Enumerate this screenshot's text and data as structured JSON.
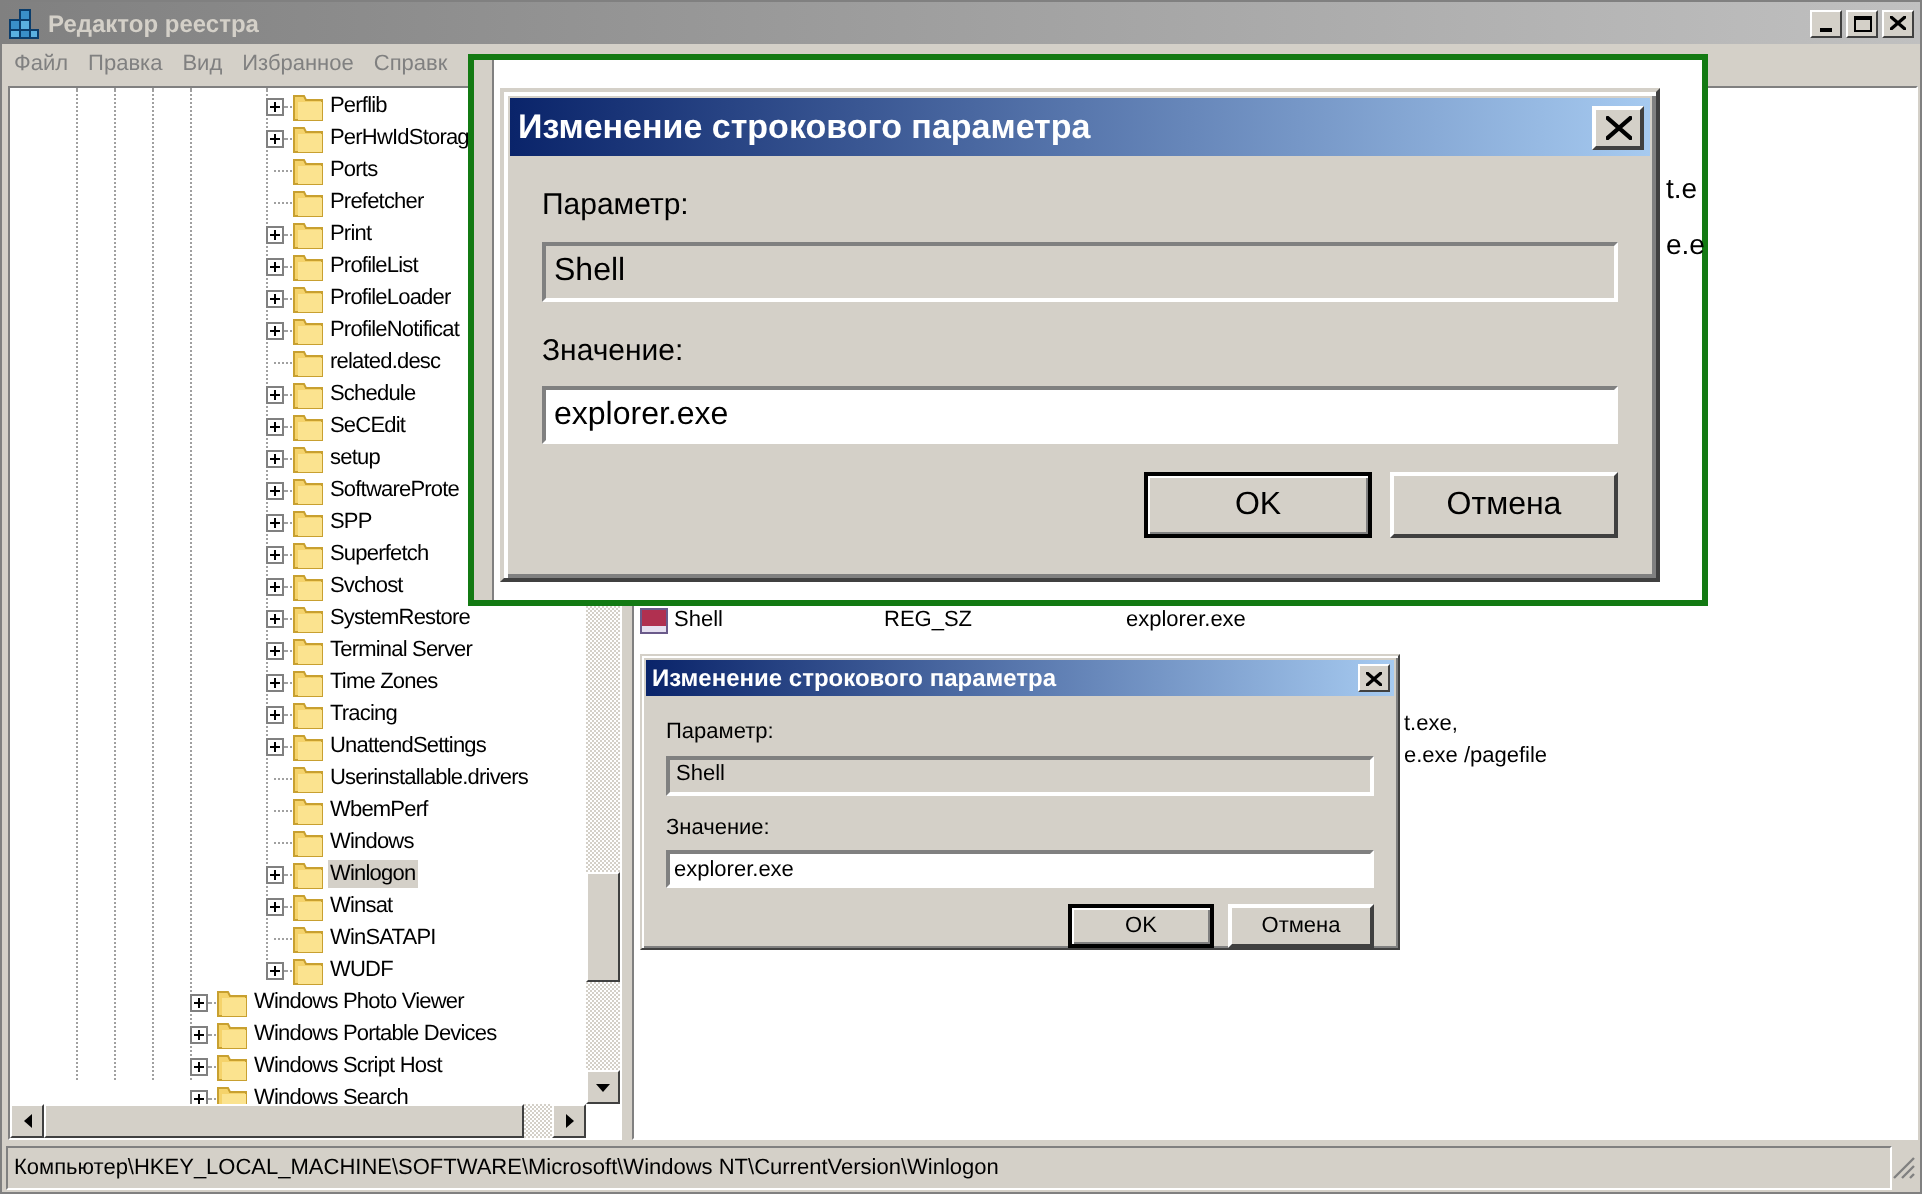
{
  "window": {
    "title": "Редактор реестра"
  },
  "menu": [
    "Файл",
    "Правка",
    "Вид",
    "Избранное",
    "Справк"
  ],
  "tree": {
    "nested_items": [
      {
        "label": "Perflib",
        "expandable": true,
        "selected": false
      },
      {
        "label": "PerHwIdStorag",
        "expandable": true,
        "selected": false
      },
      {
        "label": "Ports",
        "expandable": false,
        "selected": false
      },
      {
        "label": "Prefetcher",
        "expandable": false,
        "selected": false
      },
      {
        "label": "Print",
        "expandable": true,
        "selected": false
      },
      {
        "label": "ProfileList",
        "expandable": true,
        "selected": false
      },
      {
        "label": "ProfileLoader",
        "expandable": true,
        "selected": false
      },
      {
        "label": "ProfileNotificat",
        "expandable": true,
        "selected": false
      },
      {
        "label": "related.desc",
        "expandable": false,
        "selected": false
      },
      {
        "label": "Schedule",
        "expandable": true,
        "selected": false
      },
      {
        "label": "SeCEdit",
        "expandable": true,
        "selected": false
      },
      {
        "label": "setup",
        "expandable": true,
        "selected": false
      },
      {
        "label": "SoftwareProte",
        "expandable": true,
        "selected": false
      },
      {
        "label": "SPP",
        "expandable": true,
        "selected": false
      },
      {
        "label": "Superfetch",
        "expandable": true,
        "selected": false
      },
      {
        "label": "Svchost",
        "expandable": true,
        "selected": false
      },
      {
        "label": "SystemRestore",
        "expandable": true,
        "selected": false
      },
      {
        "label": "Terminal Server",
        "expandable": true,
        "selected": false
      },
      {
        "label": "Time Zones",
        "expandable": true,
        "selected": false
      },
      {
        "label": "Tracing",
        "expandable": true,
        "selected": false
      },
      {
        "label": "UnattendSettings",
        "expandable": true,
        "selected": false
      },
      {
        "label": "Userinstallable.drivers",
        "expandable": false,
        "selected": false
      },
      {
        "label": "WbemPerf",
        "expandable": false,
        "selected": false
      },
      {
        "label": "Windows",
        "expandable": false,
        "selected": false
      },
      {
        "label": "Winlogon",
        "expandable": true,
        "selected": true
      },
      {
        "label": "Winsat",
        "expandable": true,
        "selected": false
      },
      {
        "label": "WinSATAPI",
        "expandable": false,
        "selected": false
      },
      {
        "label": "WUDF",
        "expandable": true,
        "selected": false
      }
    ],
    "items": [
      {
        "label": "Windows Photo Viewer",
        "expandable": true,
        "selected": false
      },
      {
        "label": "Windows Portable Devices",
        "expandable": true,
        "selected": false
      },
      {
        "label": "Windows Script Host",
        "expandable": true,
        "selected": false
      },
      {
        "label": "Windows Search",
        "expandable": true,
        "selected": false
      }
    ]
  },
  "list_rows": [
    {
      "kind": "full",
      "name": "Shell",
      "type": "REG_SZ",
      "data": "explorer.exe"
    },
    {
      "kind": "partial",
      "data": "t.exe,"
    },
    {
      "kind": "partial",
      "data": "e.exe /pagefile"
    }
  ],
  "status_bar": "Компьютер\\HKEY_LOCAL_MACHINE\\SOFTWARE\\Microsoft\\Windows NT\\CurrentVersion\\Winlogon",
  "dialog": {
    "title": "Изменение строкового параметра",
    "parameter_label": "Параметр:",
    "parameter_value": "Shell",
    "value_label": "Значение:",
    "value": "explorer.exe",
    "buttons": [
      {
        "label": "OK",
        "default": true
      },
      {
        "label": "Отмена",
        "default": false
      }
    ]
  },
  "magnified_view": {
    "fragments": [
      "t.e",
      "e.e"
    ],
    "dialog": {
      "title": "Изменение строкового параметра",
      "parameter_label": "Параметр:",
      "parameter_value": "Shell",
      "value_label": "Значение:",
      "value": "explorer.exe",
      "buttons": [
        {
          "label": "OK",
          "default": true
        },
        {
          "label": "Отмена",
          "default": false
        }
      ]
    }
  }
}
